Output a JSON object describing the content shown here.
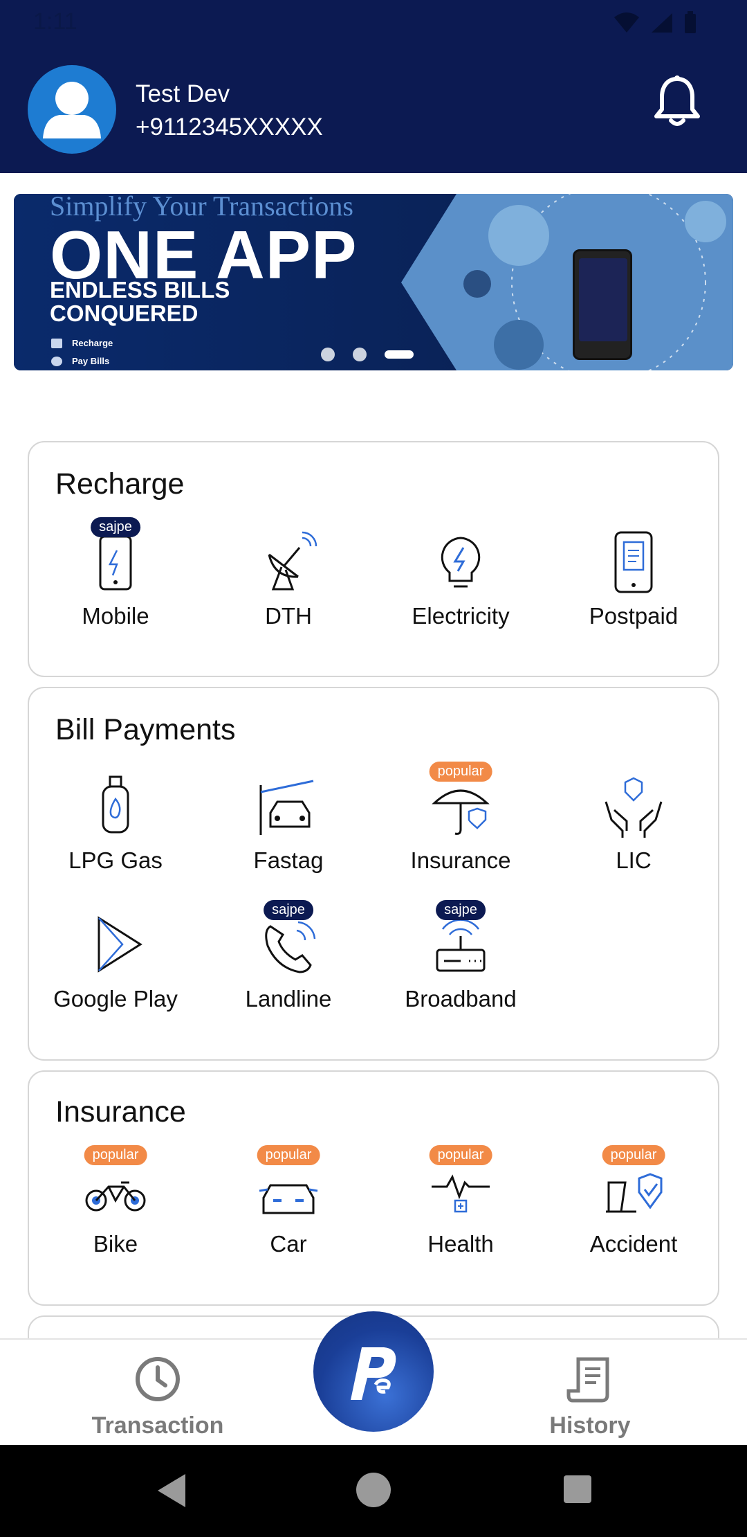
{
  "status": {
    "time": "1:11"
  },
  "user": {
    "name": "Test Dev",
    "phone": "+9112345XXXXX"
  },
  "banner": {
    "tagline": "Simplify Your Transactions",
    "title": "ONE APP",
    "subtitle_line1": "ENDLESS BILLS",
    "subtitle_line2": "CONQUERED",
    "bullets": [
      "Recharge",
      "Pay Bills"
    ],
    "dot_count": 3,
    "active_dot": 3
  },
  "recharge": {
    "title": "Recharge",
    "items": [
      {
        "label": "Mobile",
        "badge": "sajpe"
      },
      {
        "label": "DTH",
        "badge": ""
      },
      {
        "label": "Electricity",
        "badge": ""
      },
      {
        "label": "Postpaid",
        "badge": ""
      }
    ]
  },
  "bills": {
    "title": "Bill Payments",
    "items": [
      {
        "label": "LPG Gas",
        "badge": ""
      },
      {
        "label": "Fastag",
        "badge": ""
      },
      {
        "label": "Insurance",
        "badge": "popular"
      },
      {
        "label": "LIC",
        "badge": ""
      },
      {
        "label": "Google Play",
        "badge": ""
      },
      {
        "label": "Landline",
        "badge": "sajpe"
      },
      {
        "label": "Broadband",
        "badge": "sajpe"
      }
    ]
  },
  "insurance": {
    "title": "Insurance",
    "items": [
      {
        "label": "Bike",
        "badge": "popular"
      },
      {
        "label": "Car",
        "badge": "popular"
      },
      {
        "label": "Health",
        "badge": "popular"
      },
      {
        "label": "Accident",
        "badge": "popular"
      }
    ]
  },
  "nav": {
    "transaction": "Transaction",
    "history": "History"
  },
  "colors": {
    "header": "#0c1a52",
    "accent": "#1e7cd2",
    "badge_popular": "#f28a47",
    "badge_sajpe": "#0c1a52"
  }
}
